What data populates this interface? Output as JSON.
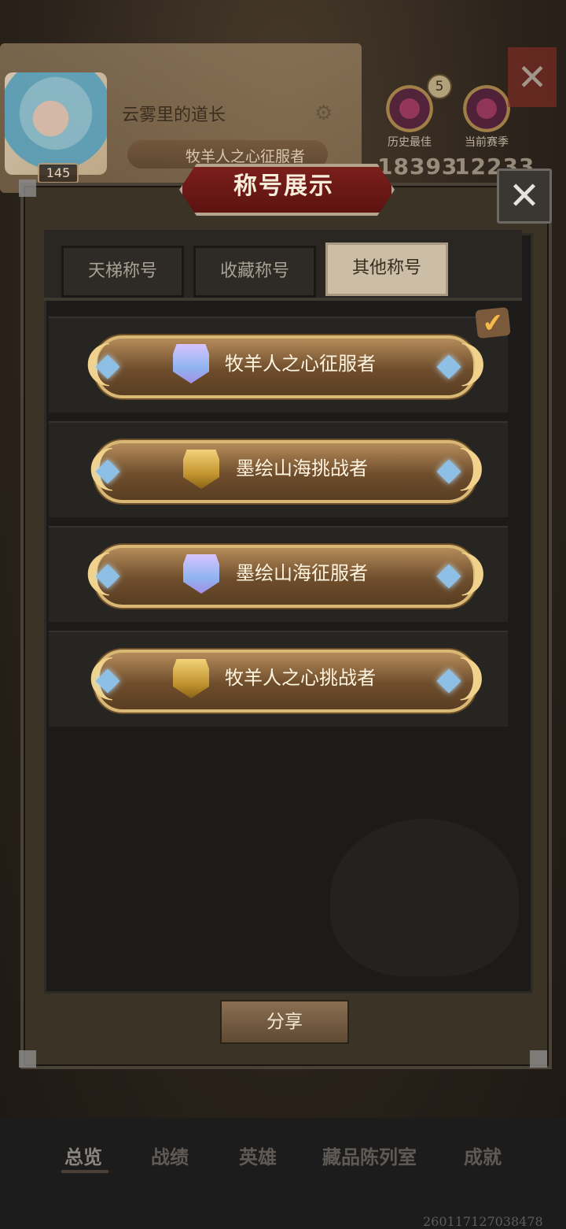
{
  "background": {
    "player_name": "云雾里的道长",
    "player_level": "145",
    "equipped_title": "牧羊人之心征服者",
    "rank_best_label": "历史最佳",
    "rank_current_label": "当前赛季",
    "rank_best_score": "18393",
    "rank_current_score": "12233",
    "rank_tier_badge": "5"
  },
  "modal": {
    "title": "称号展示",
    "tabs": [
      {
        "label": "天梯称号",
        "active": false
      },
      {
        "label": "收藏称号",
        "active": false
      },
      {
        "label": "其他称号",
        "active": true
      }
    ],
    "titles": [
      {
        "label": "牧羊人之心征服者",
        "crest": "purple-crest-icon",
        "equipped": true
      },
      {
        "label": "墨绘山海挑战者",
        "crest": "gold-crest-icon",
        "equipped": false
      },
      {
        "label": "墨绘山海征服者",
        "crest": "purple-crest-icon",
        "equipped": false
      },
      {
        "label": "牧羊人之心挑战者",
        "crest": "gold-crest-icon",
        "equipped": false
      }
    ],
    "share_label": "分享"
  },
  "bottom_nav": {
    "items": [
      "总览",
      "战绩",
      "英雄",
      "藏品陈列室",
      "成就"
    ],
    "active_index": 0
  },
  "footer_code": "260117127038478",
  "colors": {
    "title_bar_border": "#d9b774",
    "modal_title_plate": "#7b1f1c",
    "active_tab": "#cbbda6"
  }
}
